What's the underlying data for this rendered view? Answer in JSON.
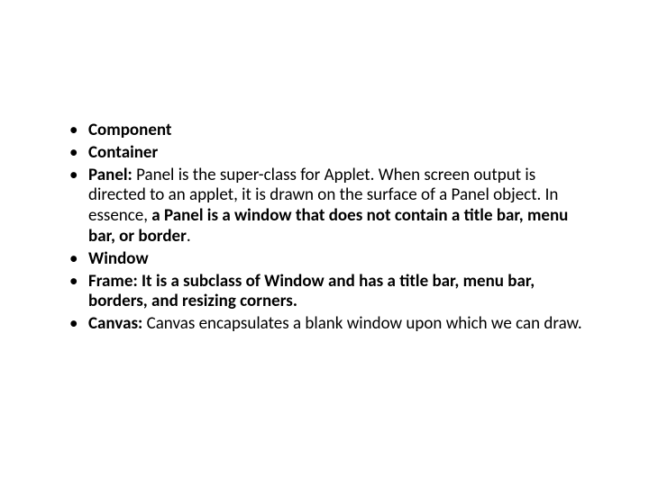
{
  "slide": {
    "items": [
      {
        "bold_label": "Component",
        "rest": ""
      },
      {
        "bold_label": "Container",
        "rest": ""
      },
      {
        "bold_label": "Panel:",
        "rest_part1": " Panel is the super-class for Applet. When screen output is directed to an applet, it is drawn on the surface of a Panel object. In essence, ",
        "bold_part2": "a Panel is a window that does not contain a title bar, menu bar, or border",
        "rest_part3": "."
      },
      {
        "bold_label": "Window",
        "rest": ""
      },
      {
        "bold_label": "Frame: It is a subclass of Window and has a title bar, menu bar, borders, and resizing corners.",
        "rest": ""
      },
      {
        "bold_label": "Canvas:",
        "rest": " Canvas encapsulates a blank window upon which we can draw."
      }
    ]
  }
}
